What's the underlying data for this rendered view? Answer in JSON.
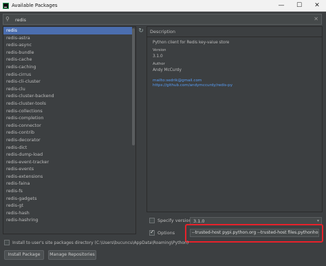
{
  "window": {
    "title": "Available Packages",
    "minimize_glyph": "—",
    "maximize_glyph": "☐",
    "close_glyph": "✕"
  },
  "search": {
    "value": "redis",
    "icon": "search-icon",
    "clear_glyph": "✕"
  },
  "packages": [
    "redis",
    "redis-astra",
    "redis-async",
    "redis-bundle",
    "redis-cache",
    "redis-caching",
    "redis-cirrus",
    "redis-cli-cluster",
    "redis-clu",
    "redis-cluster-backend",
    "redis-cluster-tools",
    "redis-collections",
    "redis-completion",
    "redis-connector",
    "redis-contrib",
    "redis-decorator",
    "redis-dict",
    "redis-dump-load",
    "redis-event-tracker",
    "redis-events",
    "redis-extensions",
    "redis-faina",
    "redis-fs",
    "redis-gadgets",
    "redis-gt",
    "redis-hash",
    "redis-hashring"
  ],
  "selected_index": 0,
  "description": {
    "header": "Description",
    "summary": "Python client for Redis key-value store",
    "version_label": "Version",
    "version_value": "3.1.0",
    "author_label": "Author",
    "author_value": "Andy McCurdy",
    "email_link": "mailto:sedrik@gmail.com",
    "url_link": "https://github.com/andymccurdy/redis-py"
  },
  "specify_version": {
    "label": "Specify version",
    "value": "3.1.0",
    "checked": false
  },
  "options": {
    "label": "Options",
    "value": "--trusted-host pypi.python.org --trusted-host files.pythonhosted.org",
    "checked": true
  },
  "install_user": {
    "label": "Install to user's site packages directory (C:\\Users\\bucuncu\\AppData\\Roaming\\Python)",
    "checked": false
  },
  "buttons": {
    "install": "Install Package",
    "manage": "Manage Repositories"
  },
  "colors": {
    "selection": "#4b6eaf",
    "highlight": "#e8212a",
    "link": "#589df6"
  }
}
